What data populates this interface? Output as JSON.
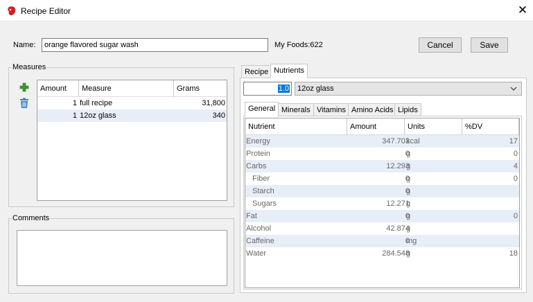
{
  "window": {
    "title": "Recipe Editor",
    "close_glyph": "✕"
  },
  "header": {
    "name_label": "Name:",
    "name_value": "orange flavored sugar wash",
    "my_foods": "My Foods:622",
    "cancel_label": "Cancel",
    "save_label": "Save"
  },
  "measures": {
    "group_title": "Measures",
    "columns": [
      "Amount",
      "Measure",
      "Grams"
    ],
    "rows": [
      {
        "amount": "1",
        "measure": "full recipe",
        "grams": "31,800"
      },
      {
        "amount": "1",
        "measure": "12oz glass",
        "grams": "340"
      }
    ],
    "add_icon": "plus-icon",
    "delete_icon": "trash-icon"
  },
  "comments": {
    "group_title": "Comments",
    "value": ""
  },
  "tabs": {
    "recipe": "Recipe",
    "nutrients": "Nutrients"
  },
  "nutrients": {
    "quantity": "1.0",
    "measure_selected": "12oz glass",
    "subtabs": [
      "General",
      "Minerals",
      "Vitamins",
      "Amino Acids",
      "Lipids"
    ],
    "columns": [
      "Nutrient",
      "Amount",
      "Units",
      "%DV"
    ],
    "rows": [
      {
        "name": "Energy",
        "amount": "347.703",
        "unit": "kcal",
        "dv": "17",
        "indent": false
      },
      {
        "name": "Protein",
        "amount": "0",
        "unit": "g",
        "dv": "0",
        "indent": false
      },
      {
        "name": "Carbs",
        "amount": "12.293",
        "unit": "g",
        "dv": "4",
        "indent": false
      },
      {
        "name": "Fiber",
        "amount": "0",
        "unit": "g",
        "dv": "0",
        "indent": true
      },
      {
        "name": "Starch",
        "amount": "0",
        "unit": "g",
        "dv": "",
        "indent": true
      },
      {
        "name": "Sugars",
        "amount": "12.271",
        "unit": "g",
        "dv": "",
        "indent": true
      },
      {
        "name": "Fat",
        "amount": "0",
        "unit": "g",
        "dv": "0",
        "indent": false
      },
      {
        "name": "Alcohol",
        "amount": "42.874",
        "unit": "g",
        "dv": "",
        "indent": false
      },
      {
        "name": "Caffeine",
        "amount": "0",
        "unit": "mg",
        "dv": "",
        "indent": false
      },
      {
        "name": "Water",
        "amount": "284.548",
        "unit": "g",
        "dv": "18",
        "indent": false
      }
    ]
  },
  "colors": {
    "row_alt": "#e8eef8",
    "selection": "#0078d7",
    "add_icon": "#3a9a2a",
    "trash_icon": "#3b7fc4",
    "app_icon": "#d42020"
  }
}
